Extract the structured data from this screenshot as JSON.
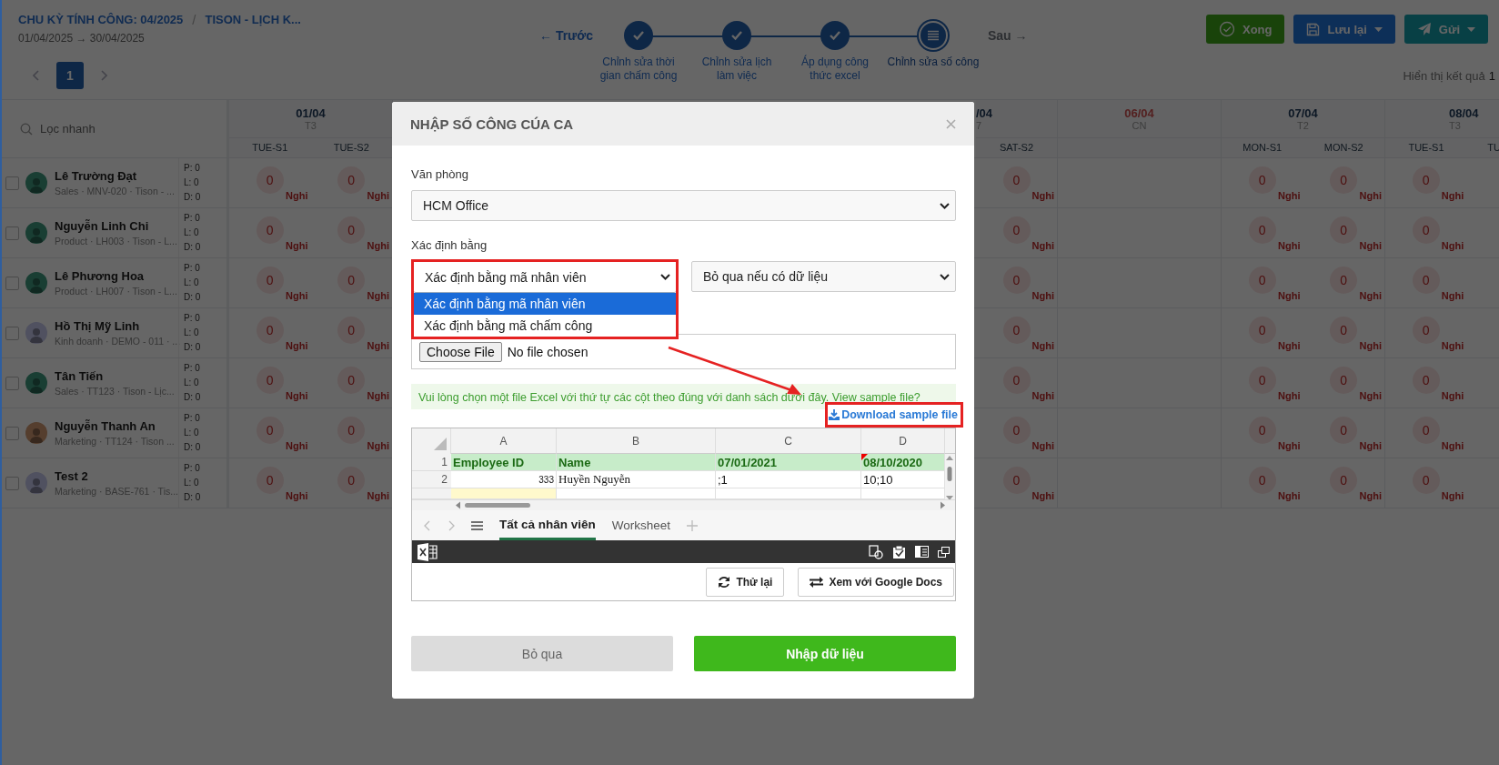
{
  "header": {
    "breadcrumb": [
      {
        "label": "CHU KỲ TÍNH CÔNG: 04/2025"
      },
      {
        "label": "TISON - LỊCH K..."
      }
    ],
    "separator": "/",
    "period": "01/04/2025 → 30/04/2025"
  },
  "pagination": {
    "pages": [
      {
        "label": "1",
        "selected": true
      }
    ]
  },
  "stepper": {
    "prev": "← Trước",
    "next": "Sau →",
    "next_disabled": true,
    "steps": [
      {
        "label": "Chỉnh sửa thời gian chấm công",
        "done": true,
        "selected": false
      },
      {
        "label": "Chỉnh sửa lịch làm việc",
        "done": true,
        "selected": false
      },
      {
        "label": "Áp dụng công thức excel",
        "done": true,
        "selected": false
      },
      {
        "label": "Chỉnh sửa số công",
        "done": false,
        "selected": true
      }
    ]
  },
  "actions": [
    {
      "label": "Xong",
      "kind": "done"
    },
    {
      "label": "Lưu lại",
      "kind": "save"
    },
    {
      "label": "Gửi",
      "kind": "send"
    }
  ],
  "result_info": {
    "label": "Hiển thị kết quả",
    "count": "1"
  },
  "search": {
    "placeholder": "Lọc nhanh"
  },
  "days": [
    {
      "date": "01/04",
      "weekday": "T3",
      "kind": "full",
      "weekend": false,
      "shifts": [
        "TUE-S1",
        "TUE-S2"
      ]
    },
    {
      "date": "/04",
      "weekday": "7",
      "kind": "partial",
      "weekend": false,
      "shifts": [
        "SAT-S2"
      ]
    },
    {
      "date": "06/04",
      "weekday": "CN",
      "kind": "full",
      "weekend": true
    },
    {
      "date": "07/04",
      "weekday": "T2",
      "kind": "full",
      "weekend": false,
      "shifts": [
        "MON-S1",
        "MON-S2"
      ]
    },
    {
      "date": "08/04",
      "weekday": "T3",
      "kind": "cut",
      "weekend": false,
      "shifts": [
        "TUE-S1",
        "TU"
      ]
    }
  ],
  "employees": [
    {
      "name": "Lê Trường Đạt",
      "meta": "Sales · MNV-020 · Tison - ...",
      "color": "#193e33",
      "checked": false,
      "stats": [
        "P: 0",
        "L: 0",
        "D: 0"
      ],
      "cells": [
        {
          "value": "0",
          "status": "Nghi"
        },
        {
          "value": "0",
          "status": "Nghi"
        },
        {
          "value": "0",
          "status": "Nghi"
        },
        {
          "value": "0",
          "status": "Nghi"
        },
        {
          "value": "0",
          "status": "Nghi"
        },
        {
          "value": "0",
          "status": "Nghi"
        }
      ]
    },
    {
      "name": "Nguyễn Linh Chi",
      "meta": "Product · LH003 · Tison - L...",
      "color": "#193e33",
      "checked": false,
      "stats": [
        "P: 0",
        "L: 0",
        "D: 0"
      ],
      "cells": [
        {
          "value": "0",
          "status": "Nghi"
        },
        {
          "value": "0",
          "status": "Nghi"
        },
        {
          "value": "0",
          "status": "Nghi"
        },
        {
          "value": "0",
          "status": "Nghi"
        },
        {
          "value": "0",
          "status": "Nghi"
        },
        {
          "value": "0",
          "status": "Nghi"
        }
      ]
    },
    {
      "name": "Lê Phương Hoa",
      "meta": "Product · LH007 · Tison - L...",
      "color": "#193e33",
      "checked": false,
      "stats": [
        "P: 0",
        "L: 0",
        "D: 0"
      ],
      "cells": [
        {
          "value": "0",
          "status": "Nghi"
        },
        {
          "value": "0",
          "status": "Nghi"
        },
        {
          "value": "0",
          "status": "Nghi"
        },
        {
          "value": "0",
          "status": "Nghi"
        },
        {
          "value": "0",
          "status": "Nghi"
        },
        {
          "value": "0",
          "status": "Nghi"
        }
      ]
    },
    {
      "name": "Hồ Thị Mỹ Linh",
      "meta": "Kinh doanh · DEMO - 011 · ...",
      "color": "#505160",
      "checked": false,
      "stats": [
        "P: 0",
        "L: 0",
        "D: 0"
      ],
      "cells": [
        {
          "value": "0",
          "status": "Nghi"
        },
        {
          "value": "0",
          "status": "Nghi"
        },
        {
          "value": "0",
          "status": "Nghi"
        },
        {
          "value": "0",
          "status": "Nghi"
        },
        {
          "value": "0",
          "status": "Nghi"
        },
        {
          "value": "0",
          "status": "Nghi"
        }
      ]
    },
    {
      "name": "Tân Tiến",
      "meta": "Sales · TT123 · Tison - Lịc...",
      "color": "#193e33",
      "checked": false,
      "stats": [
        "P: 0",
        "L: 0",
        "D: 0"
      ],
      "cells": [
        {
          "value": "0",
          "status": "Nghi"
        },
        {
          "value": "0",
          "status": "Nghi"
        },
        {
          "value": "0",
          "status": "Nghi"
        },
        {
          "value": "0",
          "status": "Nghi"
        },
        {
          "value": "0",
          "status": "Nghi"
        },
        {
          "value": "0",
          "status": "Nghi"
        }
      ]
    },
    {
      "name": "Nguyễn Thanh An",
      "meta": "Marketing · TT124 · Tison ...",
      "color": "#553e2e",
      "checked": false,
      "stats": [
        "P: 0",
        "L: 0",
        "D: 0"
      ],
      "cells": [
        {
          "value": "0",
          "status": "Nghi"
        },
        {
          "value": "0",
          "status": "Nghi"
        },
        {
          "value": "0",
          "status": "Nghi"
        },
        {
          "value": "0",
          "status": "Nghi"
        },
        {
          "value": "0",
          "status": "Nghi"
        },
        {
          "value": "0",
          "status": "Nghi"
        }
      ]
    },
    {
      "name": "Test 2",
      "meta": "Marketing · BASE-761 · Tis...",
      "color": "#505160",
      "checked": false,
      "stats": [
        "P: 0",
        "L: 0",
        "D: 0"
      ],
      "cells": [
        {
          "value": "0",
          "status": "Nghi"
        },
        {
          "value": "0",
          "status": "Nghi"
        },
        {
          "value": "0",
          "status": "Nghi"
        },
        {
          "value": "0",
          "status": "Nghi"
        },
        {
          "value": "0",
          "status": "Nghi"
        },
        {
          "value": "0",
          "status": "Nghi"
        }
      ]
    }
  ],
  "modal": {
    "title": "NHẬP SỐ CÔNG CÚA CA",
    "office": {
      "label": "Văn phòng",
      "value": "HCM Office"
    },
    "match": {
      "label": "Xác định bằng",
      "value": "Xác định bằng mã nhân viên",
      "expanded": true,
      "options": [
        {
          "label": "Xác định bằng mã nhân viên",
          "selected": true
        },
        {
          "label": "Xác định bằng mã chấm công",
          "selected": false
        }
      ]
    },
    "conflict": {
      "value": "Bỏ qua nếu có dữ liệu"
    },
    "file": {
      "button": "Choose File",
      "status": "No file chosen"
    },
    "notice": "Vui lòng chọn một file Excel với thứ tự các cột theo đúng với danh sách dưới đây. View sample file?",
    "download": "Download sample file",
    "sheet": {
      "columns": [
        "A",
        "B",
        "C",
        "D"
      ],
      "rows": [
        {
          "number": "1",
          "kind": "header",
          "cells": [
            {
              "text": "Employee ID",
              "kind": "text"
            },
            {
              "text": "Name",
              "kind": "text"
            },
            {
              "text": "07/01/2021",
              "kind": "text"
            },
            {
              "text": "08/10/2020",
              "kind": "text",
              "comment": true
            }
          ]
        },
        {
          "number": "2",
          "kind": "data",
          "cells": [
            {
              "text": "333",
              "kind": "number"
            },
            {
              "text": "Huyền Nguyễn",
              "kind": "name"
            },
            {
              "text": ";1",
              "kind": "text"
            },
            {
              "text": "10;10",
              "kind": "text"
            }
          ]
        },
        {
          "kind": "blank"
        }
      ],
      "tabs": [
        {
          "label": "Tất cả nhân viên",
          "selected": true
        },
        {
          "label": "Worksheet",
          "selected": false
        }
      ],
      "buttons": [
        {
          "label": "Thử lại",
          "kind": "retry"
        },
        {
          "label": "Xem với Google Docs",
          "kind": "swap"
        }
      ]
    },
    "buttons": [
      {
        "label": "Bỏ qua",
        "kind": "cancel"
      },
      {
        "label": "Nhập dữ liệu",
        "kind": "submit"
      }
    ]
  }
}
